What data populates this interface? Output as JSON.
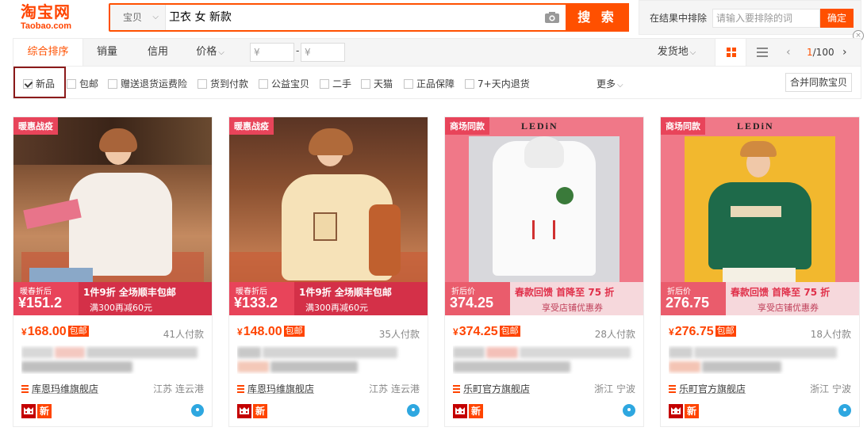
{
  "header": {
    "logo_cn": "淘宝网",
    "logo_en": "Taobao.com",
    "search_type": "宝贝",
    "search_query": "卫衣 女 新款",
    "search_button": "搜 索",
    "exclude_label": "在结果中排除",
    "exclude_placeholder": "请输入要排除的词",
    "exclude_confirm": "确定",
    "close_symbol": "×"
  },
  "sort_bar": {
    "default": "综合排序",
    "sales": "销量",
    "credit": "信用",
    "price": "价格",
    "price_min_placeholder": "¥",
    "price_max_placeholder": "¥",
    "price_dash": "-",
    "ship_from": "发货地",
    "page_current": "1",
    "page_total": "/100",
    "prev_symbol": "‹",
    "next_symbol": "›"
  },
  "filters": {
    "items": [
      {
        "label": "新品",
        "checked": true
      },
      {
        "label": "包邮",
        "checked": false
      },
      {
        "label": "赠送退货运费险",
        "checked": false
      },
      {
        "label": "货到付款",
        "checked": false
      },
      {
        "label": "公益宝贝",
        "checked": false
      },
      {
        "label": "二手",
        "checked": false
      },
      {
        "label": "天猫",
        "checked": false
      },
      {
        "label": "正品保障",
        "checked": false
      },
      {
        "label": "7+天内退货",
        "checked": false
      }
    ],
    "more": "更多",
    "merge": "合并同款宝贝"
  },
  "products": [
    {
      "price_symbol": "¥",
      "price": "168.00",
      "freeship": "包邮",
      "sales": "41人付款",
      "shop": "库恩玛维旗舰店",
      "location": "江苏 连云港",
      "new_badge": "新",
      "img_tag": "暖惠战疫",
      "banner_label": "暖春折后",
      "banner_amount": "¥151.2",
      "banner_line1": "1件9折 全场顺丰包邮",
      "banner_line2": "满300再减60元"
    },
    {
      "price_symbol": "¥",
      "price": "148.00",
      "freeship": "包邮",
      "sales": "35人付款",
      "shop": "库恩玛维旗舰店",
      "location": "江苏 连云港",
      "new_badge": "新",
      "img_tag": "暖惠战疫",
      "banner_label": "暖春折后",
      "banner_amount": "¥133.2",
      "banner_line1": "1件9折 全场顺丰包邮",
      "banner_line2": "满300再减60元"
    },
    {
      "price_symbol": "¥",
      "price": "374.25",
      "freeship": "包邮",
      "sales": "28人付款",
      "shop": "乐町官方旗舰店",
      "location": "浙江 宁波",
      "new_badge": "新",
      "img_tag": "商场同款",
      "brand": "LEDiN",
      "banner_label": "折后价",
      "banner_amount": "374.25",
      "banner_line1": "春款回馈 首降至 75 折",
      "banner_line2": "享受店铺优惠券"
    },
    {
      "price_symbol": "¥",
      "price": "276.75",
      "freeship": "包邮",
      "sales": "18人付款",
      "shop": "乐町官方旗舰店",
      "location": "浙江 宁波",
      "new_badge": "新",
      "img_tag": "商场同款",
      "brand": "LEDiN",
      "banner_label": "折后价",
      "banner_amount": "276.75",
      "banner_line1": "春款回馈 首降至 75 折",
      "banner_line2": "享受店铺优惠券"
    }
  ],
  "icons": {
    "camera": "camera-icon",
    "grid_view": "grid-view-icon",
    "list_view": "list-view-icon",
    "shop": "shop-icon",
    "tmall": "tmall-icon",
    "wangwang": "wangwang-chat-icon"
  },
  "colors": {
    "accent": "#ff5000",
    "price": "#ff4400",
    "highlight_box": "#8b1a1a"
  }
}
